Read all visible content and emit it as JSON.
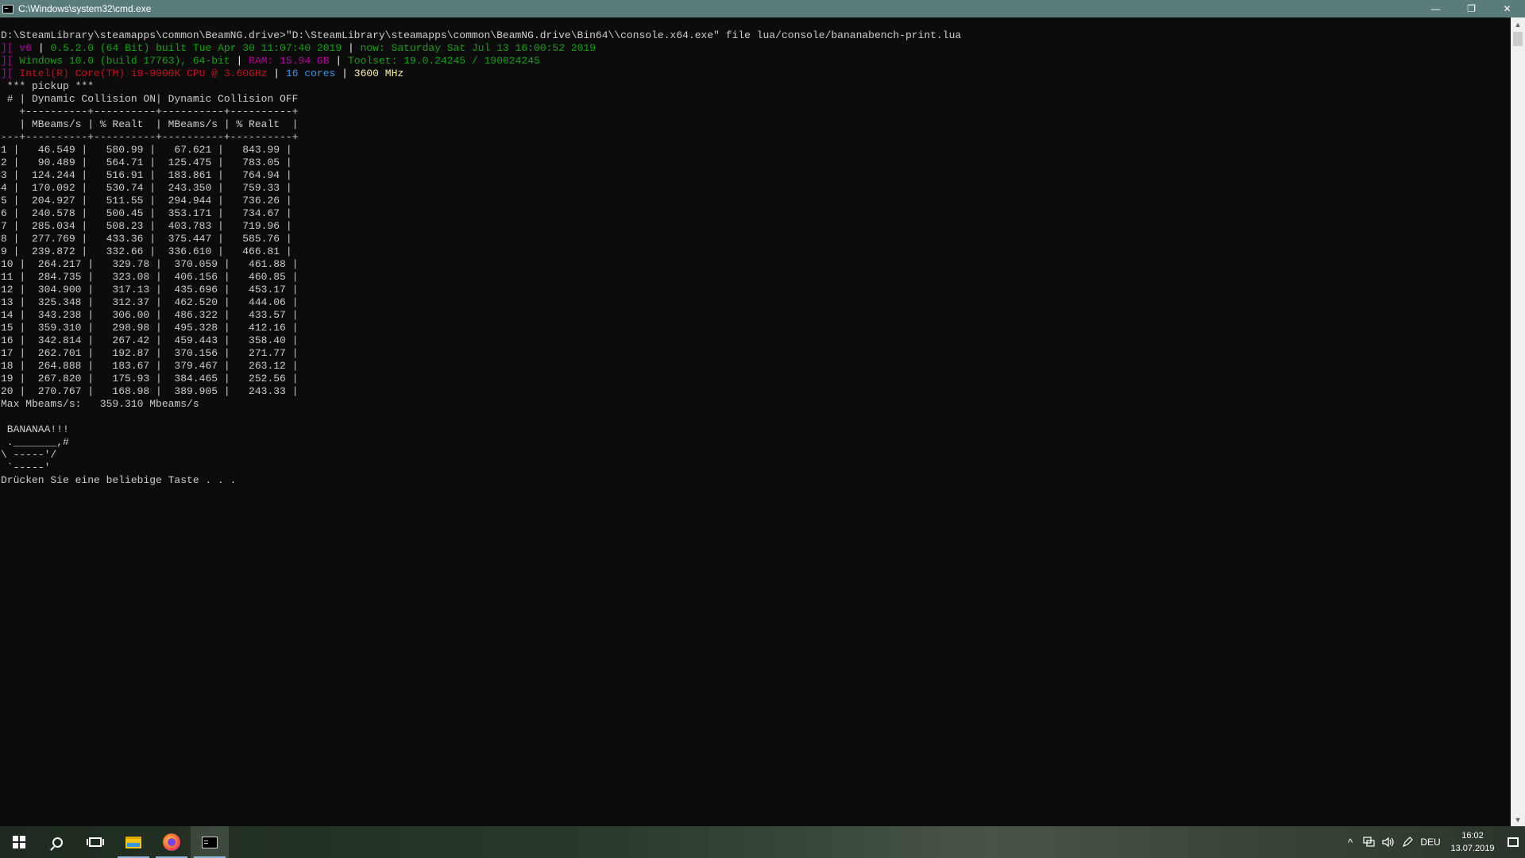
{
  "window": {
    "title": "C:\\Windows\\system32\\cmd.exe",
    "controls": {
      "minimize": "—",
      "restore": "❐",
      "close": "✕"
    }
  },
  "console": {
    "command_line": "D:\\SteamLibrary\\steamapps\\common\\BeamNG.drive>\"D:\\SteamLibrary\\steamapps\\common\\BeamNG.drive\\Bin64\\\\console.x64.exe\" file lua/console/bananabench-print.lua",
    "prefix": "][",
    "info1": {
      "v": "v6",
      "sep": "|",
      "build": "0.5.2.0 (64 Bit) built Tue Apr 30 11:07:40 2019",
      "now": "now: Saturday Sat Jul 13 16:00:52 2019"
    },
    "info2": {
      "os": "Windows 10.0 (build 17763), 64-bit",
      "sep": "|",
      "ram": "RAM: 15.94 GB",
      "toolset": "Toolset: 19.0.24245 / 190024245"
    },
    "info3": {
      "cpu": "Intel(R) Core(TM) i9-9900K CPU @ 3.60GHz",
      "sep": "|",
      "cores": "16 cores",
      "mhz": "3600 MHz"
    },
    "section": " *** pickup ***",
    "header1": " # | Dynamic Collision ON| Dynamic Collision OFF",
    "divider_top": "   +----------+----------+----------+----------+",
    "header2": "   | MBeams/s | % Realt  | MBeams/s | % Realt  |",
    "divider_mid": "---+----------+----------+----------+----------+",
    "rows": [
      "1 |   46.549 |   580.99 |   67.621 |   843.99 |",
      "2 |   90.489 |   564.71 |  125.475 |   783.05 |",
      "3 |  124.244 |   516.91 |  183.861 |   764.94 |",
      "4 |  170.092 |   530.74 |  243.350 |   759.33 |",
      "5 |  204.927 |   511.55 |  294.944 |   736.26 |",
      "6 |  240.578 |   500.45 |  353.171 |   734.67 |",
      "7 |  285.034 |   508.23 |  403.783 |   719.96 |",
      "8 |  277.769 |   433.36 |  375.447 |   585.76 |",
      "9 |  239.872 |   332.66 |  336.610 |   466.81 |",
      "10 |  264.217 |   329.78 |  370.059 |   461.88 |",
      "11 |  284.735 |   323.08 |  406.156 |   460.85 |",
      "12 |  304.900 |   317.13 |  435.696 |   453.17 |",
      "13 |  325.348 |   312.37 |  462.520 |   444.06 |",
      "14 |  343.238 |   306.00 |  486.322 |   433.57 |",
      "15 |  359.310 |   298.98 |  495.328 |   412.16 |",
      "16 |  342.814 |   267.42 |  459.443 |   358.40 |",
      "17 |  262.701 |   192.87 |  370.156 |   271.77 |",
      "18 |  264.888 |   183.67 |  379.467 |   263.12 |",
      "19 |  267.820 |   175.93 |  384.465 |   252.56 |",
      "20 |  270.767 |   168.98 |  389.905 |   243.33 |"
    ],
    "max_line": "Max Mbeams/s:   359.310 Mbeams/s",
    "banana_lines": [
      " BANANAA!!!",
      " ._______,#",
      "\\ -----'/",
      " `-----'"
    ],
    "prompt": "Drücken Sie eine beliebige Taste . . ."
  },
  "taskbar": {
    "apps": [
      {
        "name": "start",
        "icon": "windows-logo-icon"
      },
      {
        "name": "search",
        "icon": "search-icon"
      },
      {
        "name": "task-view",
        "icon": "task-view-icon"
      },
      {
        "name": "file-explorer",
        "icon": "folder-icon"
      },
      {
        "name": "firefox",
        "icon": "firefox-icon"
      },
      {
        "name": "cmd",
        "icon": "cmd-icon"
      }
    ],
    "tray": {
      "chevron": "^",
      "language": "DEU",
      "time": "16:02",
      "date": "13.07.2019"
    }
  }
}
